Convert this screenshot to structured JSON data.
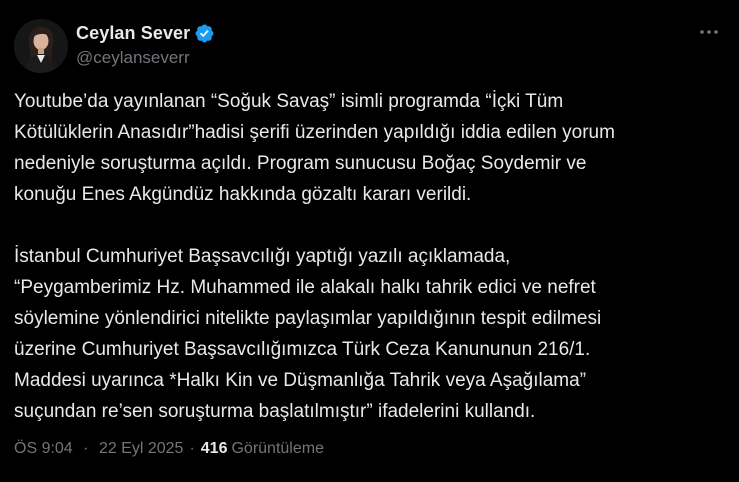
{
  "author": {
    "display_name": "Ceylan Sever",
    "handle": "@ceylanseverr",
    "verified": true,
    "verified_color": "#1d9bf0"
  },
  "more_icon": "more-horizontal-icon",
  "text": {
    "paragraph1": [
      "Youtube’da yayınlanan “Soğuk Savaş” isimli programda “İçki Tüm",
      "Kötülüklerin Anasıdır”hadisi şerifi üzerinden yapıldığı iddia edilen yorum",
      "nedeniyle soruşturma açıldı. Program sunucusu Boğaç Soydemir ve",
      "konuğu Enes Akgündüz hakkında gözaltı kararı verildi."
    ],
    "paragraph2": [
      "İstanbul Cumhuriyet Başsavcılığı yaptığı yazılı açıklamada,",
      "“Peygamberimiz Hz. Muhammed ile alakalı halkı tahrik edici ve nefret",
      "söylemine yönlendirici nitelikte paylaşımlar yapıldığının tespit edilmesi",
      "üzerine Cumhuriyet Başsavcılığımızca Türk Ceza Kanununun 216/1.",
      "Maddesi uyarınca *Halkı Kin ve Düşmanlığa Tahrik veya Aşağılama”",
      "suçundan re’sen soruşturma başlatılmıştır” ifadelerini kullandı."
    ]
  },
  "meta": {
    "time": "ÖS 9:04",
    "separator": "·",
    "date": "22 Eyl 2025",
    "views_count": "416",
    "views_label": "Görüntüleme"
  },
  "colors": {
    "background": "#000000",
    "primary_text": "#e7e9ea",
    "secondary_text": "#71767b"
  }
}
